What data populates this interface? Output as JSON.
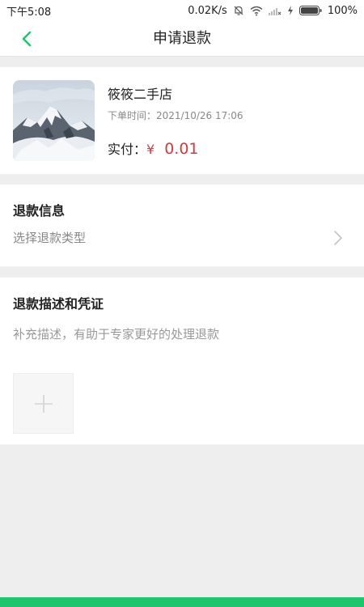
{
  "status_bar": {
    "time": "下午5:08",
    "network_speed": "0.02K/s",
    "battery": "100%"
  },
  "header": {
    "title": "申请退款"
  },
  "order": {
    "shop_name": "筱筱二手店",
    "order_time": "下单时间：2021/10/26 17:06",
    "paid_label": "实付：",
    "paid_currency": "¥",
    "paid_amount": "0.01"
  },
  "refund_info": {
    "section_title": "退款信息",
    "type_placeholder": "选择退款类型"
  },
  "refund_desc": {
    "section_title": "退款描述和凭证",
    "placeholder": "补充描述，有助于专家更好的处理退款"
  },
  "colors": {
    "accent": "#1ec66b",
    "price": "#d9383a",
    "background": "#eeeeee"
  }
}
